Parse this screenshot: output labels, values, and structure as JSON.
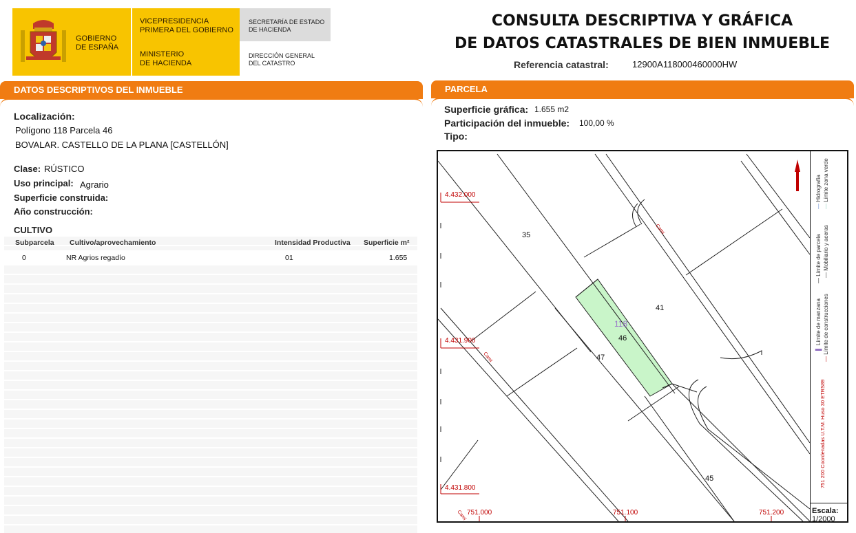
{
  "header": {
    "gov_line1": "GOBIERNO",
    "gov_line2": "DE ESPAÑA",
    "vice_line1": "VICEPRESIDENCIA",
    "vice_line2": "PRIMERA DEL GOBIERNO",
    "min_line1": "MINISTERIO",
    "min_line2": "DE HACIENDA",
    "secr_line1": "SECRETARÍA DE ESTADO",
    "secr_line2": "DE HACIENDA",
    "dgc_line1": "DIRECCIÓN GENERAL",
    "dgc_line2": "DEL CATASTRO",
    "title_line1": "CONSULTA DESCRIPTIVA Y GRÁFICA",
    "title_line2": "DE DATOS CATASTRALES DE BIEN INMUEBLE",
    "ref_label": "Referencia catastral:",
    "ref_value": "12900A118000460000HW",
    "yellow": "#f8c400",
    "grey": "#dcdcdc"
  },
  "left": {
    "section_title": "DATOS DESCRIPTIVOS DEL INMUEBLE",
    "localizacion_label": "Localización:",
    "loc_line1": "Polígono 118 Parcela 46",
    "loc_line2": "BOVALAR. CASTELLO DE LA PLANA [CASTELLÓN]",
    "clase_label": "Clase:",
    "clase_value": "RÚSTICO",
    "uso_label": "Uso principal:",
    "uso_value": "Agrario",
    "superficie_label": "Superficie construida:",
    "anio_label": "Año construcción:",
    "cultivo_title": "CULTIVO",
    "table": {
      "headers": [
        "Subparcela",
        "Cultivo/aprovechamiento",
        "Intensidad Productiva",
        "Superficie m²"
      ],
      "rows": [
        [
          "0",
          "NR Agrios regadío",
          "01",
          "1.655"
        ]
      ]
    }
  },
  "right": {
    "section_title": "PARCELA",
    "sup_label": "Superficie gráfica:",
    "sup_value": "1.655 m2",
    "part_label": "Participación del inmueble:",
    "part_value": "100,00 %",
    "tipo_label": "Tipo:",
    "map": {
      "y_ticks": [
        "4.432.000",
        "4.431.900",
        "4.431.800"
      ],
      "x_ticks": [
        "751.000",
        "751.100",
        "751.200"
      ],
      "parcel_numbers": [
        "35",
        "41",
        "46",
        "47",
        "45"
      ],
      "polygon_number": "118",
      "road_labels": [
        "Cami",
        "Cami",
        "Cami"
      ],
      "highlight_color": "#c9f5c9",
      "grid_color": "#c00000"
    },
    "legend": {
      "col1": [
        "Límite de parcela",
        "Límite de manzana",
        "Hidrografía"
      ],
      "col2": [
        "Mobiliario y aceras",
        "Límite de construcciones",
        "Límite zona verde"
      ],
      "coords": "751 200 Coordenadas U.T.M. Huso 30 ETRS89"
    },
    "scale_label": "Escala:",
    "scale_value": "1/2000"
  },
  "accent": "#f07c12"
}
